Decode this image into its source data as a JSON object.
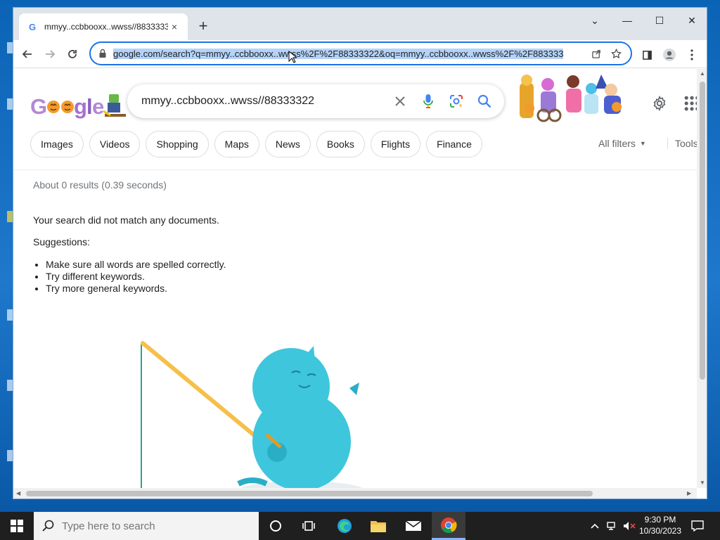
{
  "tab": {
    "title": "mmyy..ccbbooxx..wwss//8833333",
    "close": "×",
    "new": "+"
  },
  "window_controls": {
    "minimize": "—",
    "maximize": "☐",
    "close": "✕",
    "tab_search": "⌄"
  },
  "omnibox": {
    "url": "google.com/search?q=mmyy..ccbbooxx..wwss%2F%2F88333322&oq=mmyy..ccbbooxx..wwss%2F%2F883333"
  },
  "search": {
    "query": "mmyy..ccbbooxx..wwss//88333322"
  },
  "chips": [
    "Images",
    "Videos",
    "Shopping",
    "Maps",
    "News",
    "Books",
    "Flights",
    "Finance"
  ],
  "filters": {
    "all_filters": "All filters",
    "tools": "Tools"
  },
  "results": {
    "stats": "About 0 results (0.39 seconds)",
    "no_match": "Your search did not match any documents.",
    "suggestions_label": "Suggestions:",
    "suggestions": [
      "Make sure all words are spelled correctly.",
      "Try different keywords.",
      "Try more general keywords."
    ]
  },
  "taskbar": {
    "search_placeholder": "Type here to search",
    "time": "9:30 PM",
    "date": "10/30/2023"
  },
  "colors": {
    "accent": "#1a73e8",
    "omnibox_selection": "#b4d3f8",
    "desktop": "#0b63b5",
    "taskbar": "#1f1f1f"
  }
}
